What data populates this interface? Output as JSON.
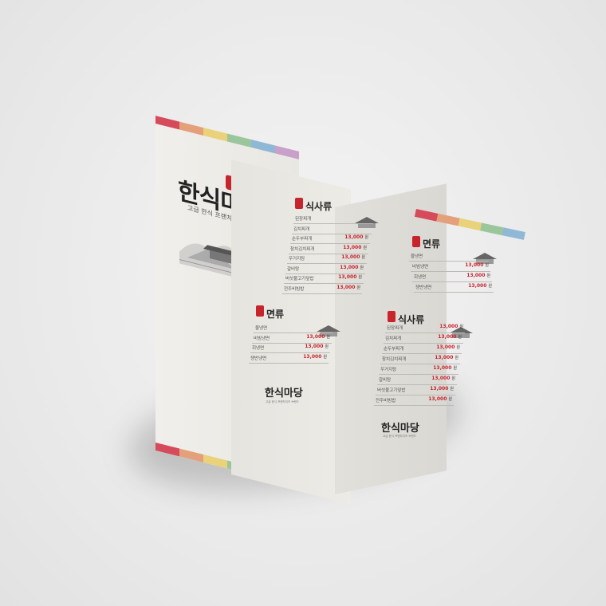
{
  "brochure": {
    "brand_name": "한식마당",
    "tagline": "고급 한식 프랜차이즈 브랜드",
    "footer_sub": "고급 한식 프랜차이즈 브랜드"
  },
  "panel2": {
    "section1": {
      "title": "식사류",
      "items": [
        {
          "name": "된장찌개",
          "price": ""
        },
        {
          "name": "김치찌개",
          "price": ""
        },
        {
          "name": "순두부찌개",
          "price": "13,000"
        },
        {
          "name": "참치김치찌개",
          "price": "13,000"
        },
        {
          "name": "우거지탕",
          "price": "13,000"
        },
        {
          "name": "갈비탕",
          "price": "13,000"
        },
        {
          "name": "버섯불고기덮밥",
          "price": "13,000"
        },
        {
          "name": "전주비빔밥",
          "price": "13,000"
        }
      ]
    },
    "section2": {
      "title": "면류",
      "items": [
        {
          "name": "물냉면",
          "price": ""
        },
        {
          "name": "비빔냉면",
          "price": "13,000"
        },
        {
          "name": "회냉면",
          "price": "13,000"
        },
        {
          "name": "쟁반냉면",
          "price": "13,000"
        }
      ]
    }
  },
  "panel3": {
    "section1": {
      "title": "면류",
      "items": [
        {
          "name": "물냉면",
          "price": ""
        },
        {
          "name": "비빔냉면",
          "price": "13,000"
        },
        {
          "name": "회냉면",
          "price": "13,000"
        },
        {
          "name": "쟁반냉면",
          "price": "13,000"
        }
      ]
    },
    "section2": {
      "title": "식사류",
      "items": [
        {
          "name": "된장찌개",
          "price": "13,000"
        },
        {
          "name": "김치찌개",
          "price": "13,000"
        },
        {
          "name": "순두부찌개",
          "price": "13,000"
        },
        {
          "name": "참치김치찌개",
          "price": "13,000"
        },
        {
          "name": "우거지탕",
          "price": "13,000"
        },
        {
          "name": "갈비탕",
          "price": "13,000"
        },
        {
          "name": "버섯불고기덮밥",
          "price": "13,000"
        },
        {
          "name": "전주비빔밥",
          "price": "13,000"
        }
      ]
    }
  },
  "currency_unit": "원",
  "colors": {
    "accent_red": "#c8242c",
    "stripe": [
      "#d64b5c",
      "#e4a07a",
      "#e9d27a",
      "#9bc59a",
      "#8fb8d6",
      "#c9a0c9",
      "#d64b5c",
      "#e4a07a"
    ]
  }
}
